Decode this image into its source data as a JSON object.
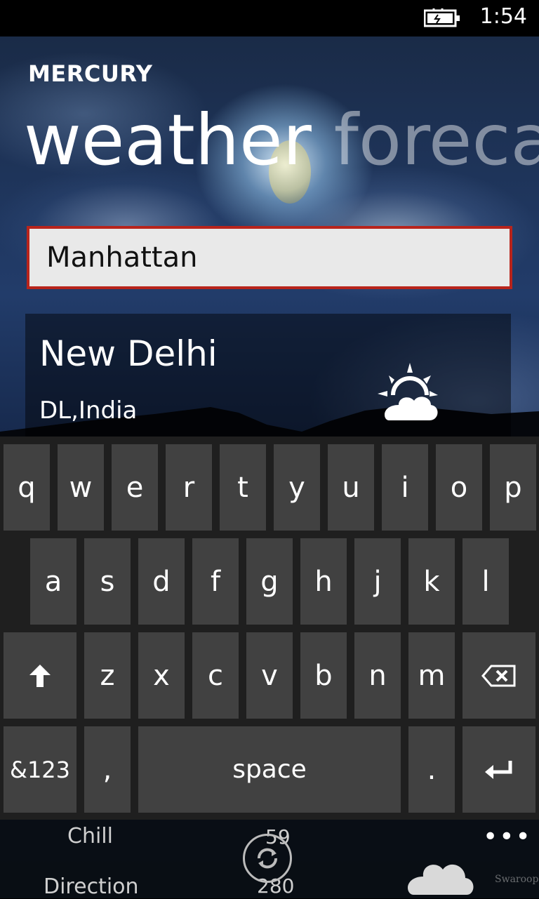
{
  "status": {
    "time": "1:54",
    "battery_icon": "battery-charging-icon"
  },
  "app": {
    "name": "MERCURY"
  },
  "pivot": {
    "active": "weather",
    "inactive": "foreca"
  },
  "search": {
    "value": "Manhattan"
  },
  "city": {
    "name": "New Delhi",
    "region": "DL,India",
    "condition_icon": "partly-cloudy-icon"
  },
  "keyboard": {
    "row1": [
      "q",
      "w",
      "e",
      "r",
      "t",
      "y",
      "u",
      "i",
      "o",
      "p"
    ],
    "row2": [
      "a",
      "s",
      "d",
      "f",
      "g",
      "h",
      "j",
      "k",
      "l"
    ],
    "row3": [
      "z",
      "x",
      "c",
      "v",
      "b",
      "n",
      "m"
    ],
    "shift_icon": "shift-arrow-icon",
    "backspace_icon": "backspace-icon",
    "symbols_label": "&123",
    "comma_label": ",",
    "space_label": "space",
    "period_label": ".",
    "enter_icon": "enter-icon"
  },
  "app_bar": {
    "chill_label": "Chill",
    "chill_value": "59",
    "direction_label": "Direction",
    "direction_value": "280",
    "more_label": "•••",
    "refresh_icon": "refresh-icon",
    "cloud_icon": "cloud-icon",
    "watermark": "SwaroopR"
  },
  "colors": {
    "accent": "#b8241c",
    "key_bg": "#414141",
    "keyboard_bg": "#1f1f1f"
  }
}
